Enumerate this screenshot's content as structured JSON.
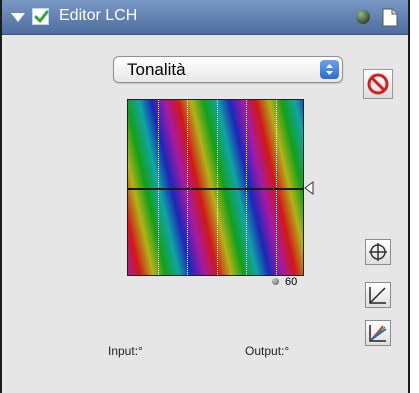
{
  "header": {
    "title": "Editor LCH",
    "enabled": true
  },
  "mode_select": {
    "selected": "Tonalità"
  },
  "graph": {
    "dotted_column_count": 5,
    "crosshair_level": 0.5,
    "legend_value": "60"
  },
  "readouts": {
    "input_label": "Input:°",
    "output_label": "Output:°"
  },
  "icons": {
    "disclosure": "disclosure-triangle-icon",
    "enable": "checkbox-icon",
    "status": "status-dot-icon",
    "page": "document-icon",
    "reset": "no-entry-icon",
    "picker": "crosshair-picker-icon",
    "curve_linear": "linear-curve-icon",
    "curve_color": "color-curve-icon"
  },
  "colors": {
    "title_bar": "#5f7fb1",
    "panel_bg": "#e6e6e6",
    "select_accent": "#2c6cd2",
    "reset_red": "#d42020",
    "check_green": "#2ea83b"
  }
}
